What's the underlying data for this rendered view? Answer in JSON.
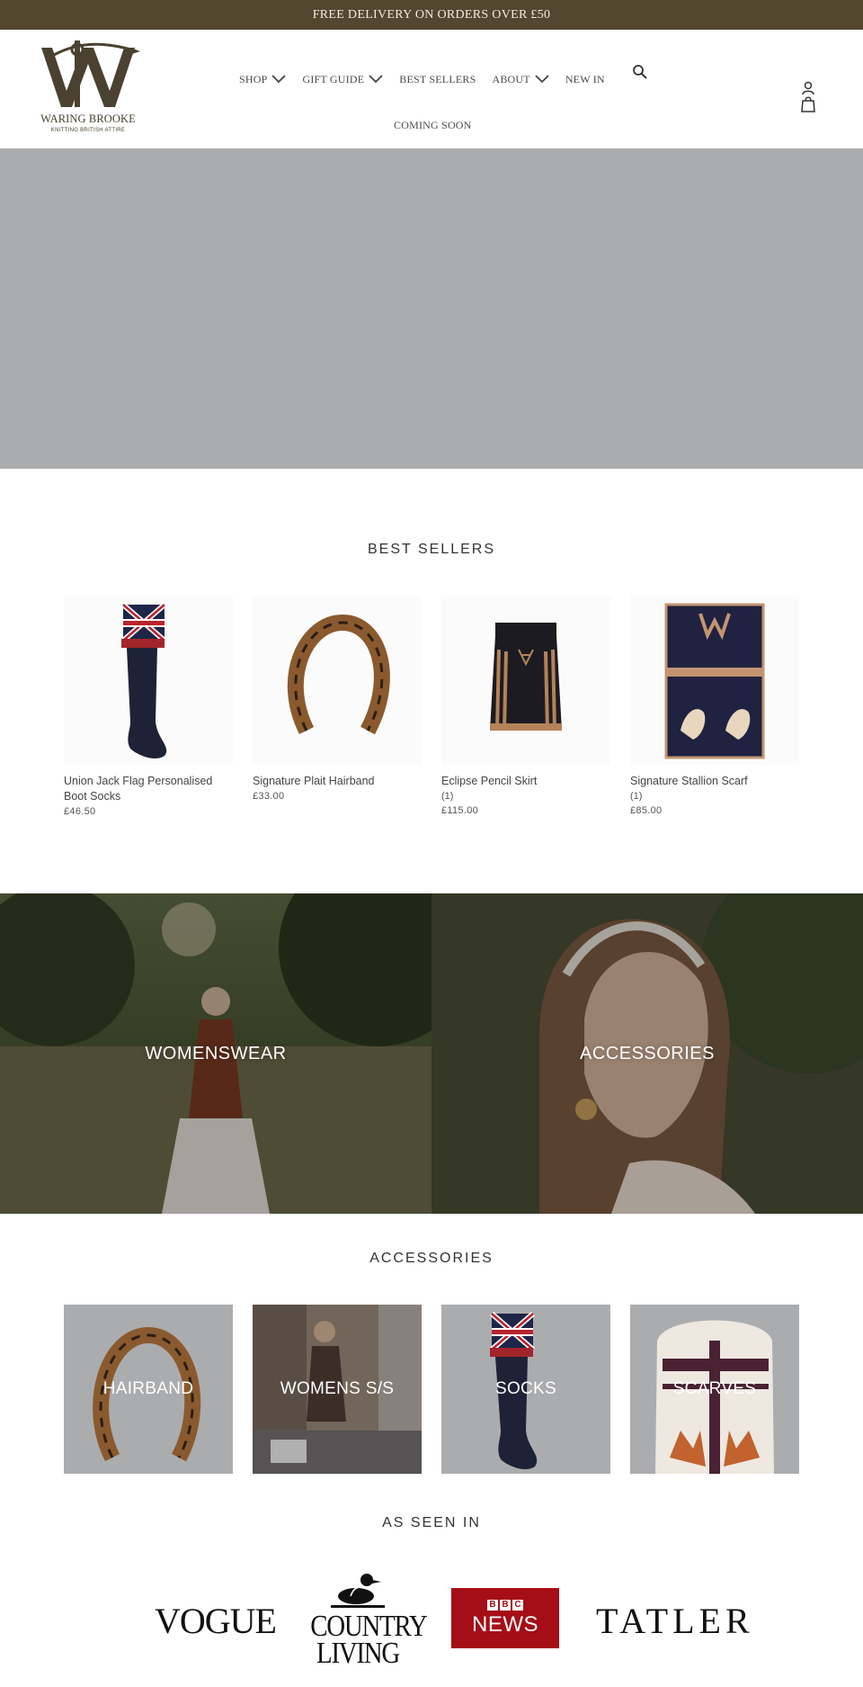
{
  "announcement": {
    "text": "FREE DELIVERY ON ORDERS OVER £50"
  },
  "brand": {
    "name": "WARING BROOKE",
    "tagline": "KNITTING BRITISH ATTIRE",
    "monogram": "W",
    "color": "#54472f"
  },
  "nav": {
    "items": [
      {
        "label": "SHOP",
        "dropdown": true
      },
      {
        "label": "GIFT GUIDE",
        "dropdown": true
      },
      {
        "label": "BEST SELLERS",
        "dropdown": false
      },
      {
        "label": "ABOUT",
        "dropdown": true
      },
      {
        "label": "NEW IN",
        "dropdown": false
      }
    ],
    "second_row": "COMING SOON",
    "icons": [
      "search-icon",
      "account-icon",
      "cart-icon"
    ]
  },
  "best_sellers": {
    "title": "BEST SELLERS",
    "products": [
      {
        "name": "Union Jack Flag Personalised Boot Socks",
        "reviews": "",
        "price": "£46.50"
      },
      {
        "name": "Signature Plait Hairband",
        "reviews": "",
        "price": "£33.00"
      },
      {
        "name": "Eclipse Pencil Skirt",
        "reviews": "(1)",
        "price": "£115.00"
      },
      {
        "name": "Signature Stallion Scarf",
        "reviews": "(1)",
        "price": "£85.00"
      }
    ]
  },
  "collections": [
    {
      "label": "WOMENSWEAR"
    },
    {
      "label": "ACCESSORIES"
    }
  ],
  "accessories": {
    "title": "ACCESSORIES",
    "tiles": [
      {
        "label": "HAIRBAND"
      },
      {
        "label": "WOMENS S/S"
      },
      {
        "label": "SOCKS"
      },
      {
        "label": "SCARVES"
      }
    ]
  },
  "press": {
    "title": "AS SEEN IN",
    "logos": [
      {
        "name": "VOGUE"
      },
      {
        "name": "COUNTRY LIVING",
        "line1": "COUNTRY",
        "line2": "LIVING"
      },
      {
        "name": "BBC NEWS",
        "line1": "BBC",
        "line2": "NEWS"
      },
      {
        "name": "TATLER"
      }
    ]
  },
  "colors": {
    "announcement_bg": "#54472f",
    "hero_bg": "#abacae",
    "bbc_red": "#a50e16"
  }
}
